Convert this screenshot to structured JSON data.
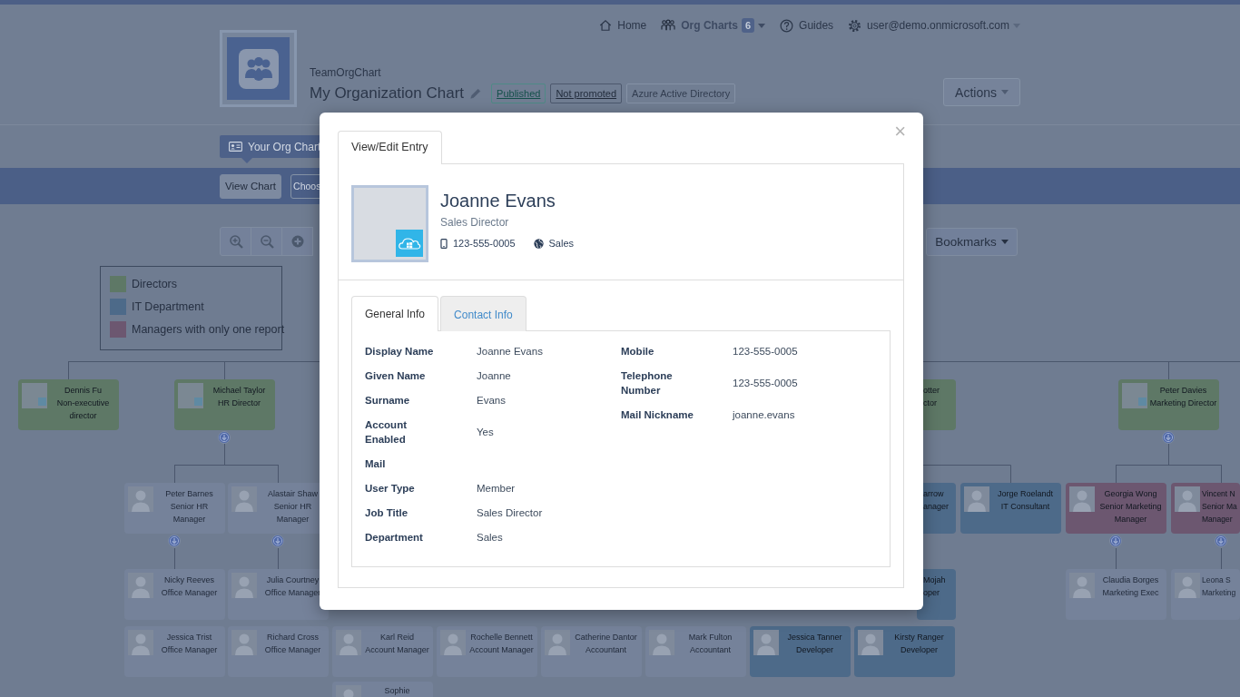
{
  "top_nav": [
    {
      "label": "Home",
      "selected": false,
      "dropdown": false
    },
    {
      "label": "Org Charts",
      "selected": true,
      "dropdown": true,
      "badge": "6"
    },
    {
      "label": "Guides",
      "selected": false,
      "dropdown": false
    },
    {
      "label": "user@demo.onmicrosoft.com",
      "selected": false,
      "dropdown": true
    }
  ],
  "header": {
    "app_name": "TeamOrgChart",
    "chart_title": "My Organization Chart",
    "tags": [
      {
        "label": "Published",
        "kind": "published"
      },
      {
        "label": "Not promoted",
        "kind": "unpromoted"
      },
      {
        "label": "Azure Active Directory",
        "kind": "source"
      }
    ],
    "actions_button": "Actions"
  },
  "view_tabs": [
    {
      "label": "Your Org Chart",
      "selected": true
    }
  ],
  "sub_toolbar": [
    {
      "label": "View Chart",
      "selected": true
    },
    {
      "label": "Choos",
      "selected": false
    }
  ],
  "bookmarks_button": "Bookmarks",
  "legend": [
    {
      "label": "Directors",
      "color": "#5e7866"
    },
    {
      "label": "IT Department",
      "color": "#4d6a89"
    },
    {
      "label": "Managers with only one report",
      "color": "#6c5770"
    }
  ],
  "org_chart": {
    "nodes": [
      {
        "name": "Dennis Fu",
        "title": "Non-executive director",
        "kind": "photo",
        "color": "#5e7866",
        "expandable": false
      },
      {
        "name": "Michael Taylor",
        "title": "HR Director",
        "kind": "photo",
        "color": "#5e7866",
        "expandable": true
      },
      {
        "name": "otter",
        "title": "ctor",
        "kind": "fragment",
        "color": "#5e7866",
        "expandable": false
      },
      {
        "name": "Peter Davies",
        "title": "Marketing Director",
        "kind": "photo",
        "color": "#5e7866",
        "expandable": true
      },
      {
        "name": "Peter Barnes",
        "title": "Senior HR Manager",
        "kind": "avatar",
        "expandable": true
      },
      {
        "name": "Alastair Shaw",
        "title": "Senior HR Manager",
        "kind": "avatar",
        "expandable": true
      },
      {
        "name": "arrow",
        "title": "anager",
        "kind": "fragment",
        "color": "#4d6a89",
        "expandable": false
      },
      {
        "name": "Jorge Roelandt",
        "title": "IT Consultant",
        "kind": "avatar",
        "color": "#4d6a89",
        "expandable": false
      },
      {
        "name": "Georgia Wong",
        "title": "Senior Marketing Manager",
        "kind": "avatar",
        "color": "#6c5770",
        "expandable": true
      },
      {
        "name": "Vincent N",
        "title": "Senior Ma Manager",
        "kind": "edge",
        "color": "#6c5770",
        "expandable": true
      },
      {
        "name": "Nicky Reeves",
        "title": "Office Manager",
        "kind": "avatar",
        "expandable": false
      },
      {
        "name": "Julia Courtney",
        "title": "Office Manager",
        "kind": "avatar",
        "expandable": false
      },
      {
        "name": "Mojah",
        "title": "oper",
        "kind": "fragment",
        "color": "#4d6a89",
        "expandable": false
      },
      {
        "name": "Claudia Borges",
        "title": "Marketing Exec",
        "kind": "avatar",
        "expandable": false
      },
      {
        "name": "Leona S",
        "title": "Marketing",
        "kind": "edge",
        "expandable": false
      },
      {
        "name": "Jessica Trist",
        "title": "Office Manager",
        "kind": "avatar",
        "expandable": false
      },
      {
        "name": "Richard Cross",
        "title": "Office Manager",
        "kind": "avatar",
        "expandable": false
      },
      {
        "name": "Karl Reid",
        "title": "Account Manager",
        "kind": "avatar",
        "expandable": false
      },
      {
        "name": "Rochelle Bennett",
        "title": "Account Manager",
        "kind": "avatar",
        "expandable": false
      },
      {
        "name": "Catherine Dantor",
        "title": "Accountant",
        "kind": "avatar",
        "expandable": false
      },
      {
        "name": "Mark Fulton",
        "title": "Accountant",
        "kind": "avatar",
        "expandable": false
      },
      {
        "name": "Jessica Tanner",
        "title": "Developer",
        "kind": "avatar",
        "color": "#4d6a89",
        "expandable": false
      },
      {
        "name": "Kirsty Ranger",
        "title": "Developer",
        "kind": "avatar",
        "color": "#4d6a89",
        "expandable": false
      },
      {
        "name": "Sophie",
        "kind": "avatar",
        "expandable": false
      }
    ]
  },
  "modal": {
    "close_symbol": "×",
    "tabs": [
      {
        "label": "View/Edit Entry",
        "selected": true
      }
    ],
    "profile": {
      "name": "Joanne Evans",
      "job_title": "Sales Director",
      "phone": "123-555-0005",
      "department": "Sales"
    },
    "detail_tabs": [
      {
        "label": "General Info",
        "selected": true
      },
      {
        "label": "Contact Info",
        "selected": false
      }
    ],
    "fields_left": [
      {
        "label": "Display Name",
        "value": "Joanne Evans"
      },
      {
        "label": "Given Name",
        "value": "Joanne"
      },
      {
        "label": "Surname",
        "value": "Evans"
      },
      {
        "label": "Account Enabled",
        "value": "Yes"
      },
      {
        "label": "Mail"
      },
      {
        "label": "User Type",
        "value": "Member"
      },
      {
        "label": "Job Title",
        "value": "Sales Director"
      },
      {
        "label": "Department",
        "value": "Sales"
      }
    ],
    "fields_right": [
      {
        "label": "Mobile",
        "value": "123-555-0005"
      },
      {
        "label": "Telephone Number",
        "value": "123-555-0005"
      },
      {
        "label": "Mail Nickname",
        "value": "joanne.evans"
      }
    ]
  }
}
